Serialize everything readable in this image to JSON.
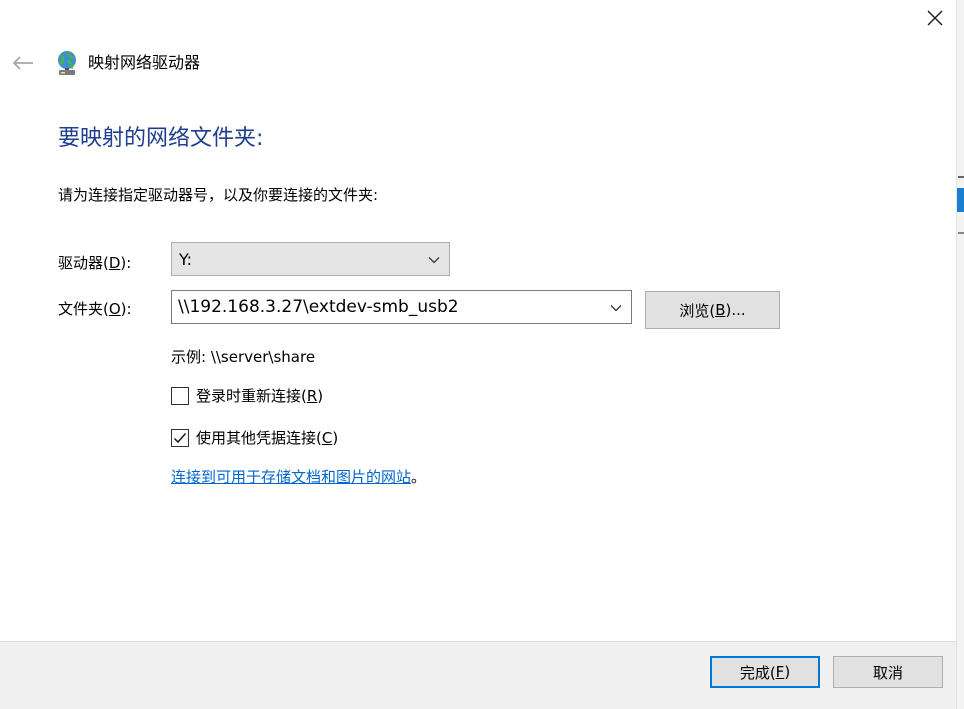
{
  "window": {
    "title": "映射网络驱动器",
    "close_icon": "close-icon",
    "back_icon": "back-arrow-icon",
    "title_icon": "network-drive-icon"
  },
  "main": {
    "heading": "要映射的网络文件夹:",
    "instruction": "请为连接指定驱动器号，以及你要连接的文件夹:"
  },
  "drive": {
    "label_prefix": "驱动器(",
    "label_key": "D",
    "label_suffix": "):",
    "value": "Y:"
  },
  "folder": {
    "label_prefix": "文件夹(",
    "label_key": "O",
    "label_suffix": "):",
    "value": "\\\\192.168.3.27\\extdev-smb_usb2"
  },
  "browse": {
    "label_prefix": "浏览(",
    "label_key": "B",
    "label_suffix": ")..."
  },
  "example": "示例: \\\\server\\share",
  "reconnect": {
    "label_prefix": "登录时重新连接(",
    "label_key": "R",
    "label_suffix": ")",
    "checked": false
  },
  "credentials": {
    "label_prefix": "使用其他凭据连接(",
    "label_key": "C",
    "label_suffix": ")",
    "checked": true
  },
  "storage_link": {
    "text": "连接到可用于存储文档和图片的网站",
    "suffix": "。"
  },
  "footer": {
    "finish_prefix": "完成(",
    "finish_key": "F",
    "finish_suffix": ")",
    "cancel_label": "取消"
  },
  "colors": {
    "heading": "#1f3e8f",
    "link": "#0066cc",
    "accent": "#0078d7"
  }
}
